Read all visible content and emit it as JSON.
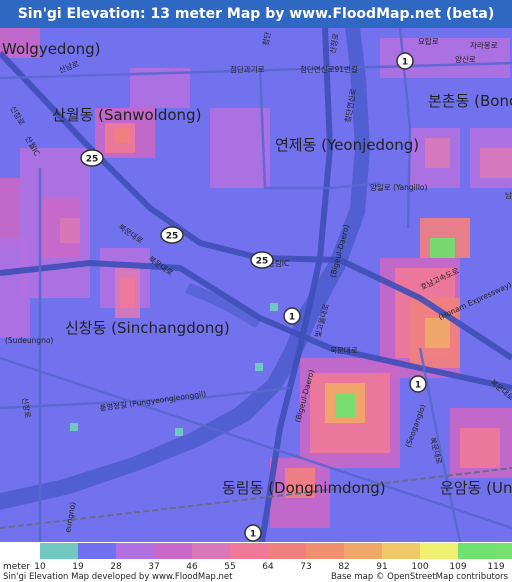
{
  "title": "Sin'gi Elevation: 13 meter Map by www.FloodMap.net (beta)",
  "colors": {
    "title_bg": "#2f68c2",
    "base_low": "#7070f0",
    "river": "#4050c8",
    "road": "#5560c8",
    "highway": "#3048b0"
  },
  "places": [
    {
      "name": "wolgyedong",
      "text": "Wolgyedong)",
      "size": "large"
    },
    {
      "name": "sanwoldong",
      "text": "산월동 (Sanwoldong)",
      "size": "large"
    },
    {
      "name": "yeonjedong",
      "text": "연제동 (Yeonjedong)",
      "size": "large"
    },
    {
      "name": "bonchondong",
      "text": "본촌동 (Boncho",
      "size": "large"
    },
    {
      "name": "sinchangdong",
      "text": "신창동 (Sinchangdong)",
      "size": "large"
    },
    {
      "name": "dongnimdong",
      "text": "동림동 (Dongnimdong)",
      "size": "large"
    },
    {
      "name": "unamdong",
      "text": "운암동 (Una",
      "size": "large"
    }
  ],
  "road_labels": [
    {
      "name": "cheomdangwagiro",
      "text": "첨단과기로"
    },
    {
      "name": "cheomdanyeonsinro91",
      "text": "첨단연신로91번길"
    },
    {
      "name": "cheomdanyeonsinro",
      "text": "첨단연신로"
    },
    {
      "name": "sinchangro",
      "text": "신창로"
    },
    {
      "name": "sannamro",
      "text": "산남로"
    },
    {
      "name": "sinnamic",
      "text": "산월IC"
    },
    {
      "name": "bukmunro",
      "text": "북문대로"
    },
    {
      "name": "bukmunro2",
      "text": "북문대로"
    },
    {
      "name": "dongrimic",
      "text": "동림IC"
    },
    {
      "name": "bigeumdaero",
      "text": "(Bigeul-Daero)"
    },
    {
      "name": "bigeumdaero2",
      "text": "(Bigeul-Daero)"
    },
    {
      "name": "honamexpressway",
      "text": "(Honam Expressway)"
    },
    {
      "name": "honamgosokdoro",
      "text": "호남고속도로"
    },
    {
      "name": "yangilro",
      "text": "양일로 (Yangillo)"
    },
    {
      "name": "pungyeongjeonggil",
      "text": "풍영정길 (Pungyeongjeonggil)"
    },
    {
      "name": "sudeungno",
      "text": "(Sudeungno)"
    },
    {
      "name": "seoganglo",
      "text": "(Seoganglo)"
    },
    {
      "name": "yotgollo",
      "text": "요탑로"
    },
    {
      "name": "jaseokro",
      "text": "자라봉로"
    },
    {
      "name": "yangsanro",
      "text": "양산로"
    },
    {
      "name": "bigeumro",
      "text": "빛고을대로"
    },
    {
      "name": "bukmunro3",
      "text": "북문대로"
    },
    {
      "name": "sanjeongro",
      "text": "산정로"
    },
    {
      "name": "bukmunro4",
      "text": "복문대로"
    },
    {
      "name": "namro",
      "text": "남로"
    },
    {
      "name": "ungeon",
      "text": "eungno)"
    },
    {
      "name": "sinchangro2",
      "text": "신창로"
    },
    {
      "name": "bukmunro5",
      "text": "북문대로"
    },
    {
      "name": "cheomdan",
      "text": "첨단"
    }
  ],
  "route_shields": [
    {
      "name": "route-25-sanwol",
      "text": "25"
    },
    {
      "name": "route-25-center",
      "text": "25"
    },
    {
      "name": "route-25-dongrim",
      "text": "25"
    },
    {
      "name": "route-1-center",
      "text": "1"
    },
    {
      "name": "route-1-bonchon",
      "text": "1"
    },
    {
      "name": "route-1-east",
      "text": "1"
    },
    {
      "name": "route-1-south",
      "text": "1"
    }
  ],
  "legend": {
    "meter_label": "meter",
    "ticks": [
      "10",
      "19",
      "28",
      "37",
      "46",
      "55",
      "64",
      "73",
      "82",
      "91",
      "100",
      "109",
      "119"
    ],
    "colors": [
      "#70c8c0",
      "#7070f0",
      "#b070e0",
      "#c868c8",
      "#d878b8",
      "#f07898",
      "#f08080",
      "#f09070",
      "#f0a868",
      "#f0c868",
      "#f0f070",
      "#70e070",
      "#78e070"
    ],
    "credit": "Sin'gi Elevation Map developed by www.FloodMap.net",
    "basemap": "Base map © OpenStreetMap contributors"
  }
}
